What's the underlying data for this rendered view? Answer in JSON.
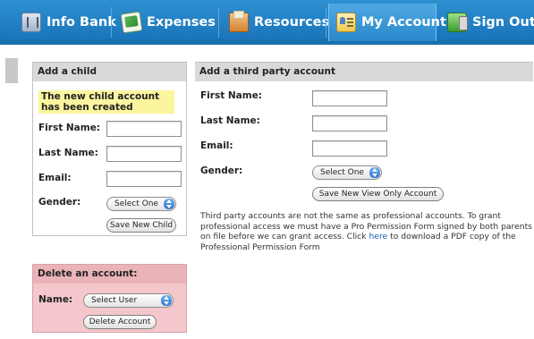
{
  "nav": {
    "items": [
      {
        "label": "Info Bank",
        "icon": "info-bank-icon"
      },
      {
        "label": "Expenses",
        "icon": "expenses-icon"
      },
      {
        "label": "Resources",
        "icon": "resources-icon"
      },
      {
        "label": "My Account",
        "icon": "my-account-icon",
        "active": true
      },
      {
        "label": "Sign Out",
        "icon": "sign-out-icon"
      }
    ]
  },
  "add_child": {
    "title": "Add a child",
    "notice": "The new child account has been created",
    "first_name_label": "First Name:",
    "last_name_label": "Last Name:",
    "email_label": "Email:",
    "gender_label": "Gender:",
    "gender_value": "Select One",
    "save_button": "Save New Child"
  },
  "third_party": {
    "title": "Add a third party account",
    "first_name_label": "First Name:",
    "last_name_label": "Last Name:",
    "email_label": "Email:",
    "gender_label": "Gender:",
    "gender_value": "Select One",
    "save_button": "Save New View Only Account",
    "note_before_link": "Third party accounts are not the same as professional accounts. To grant professional access we must have a Pro Permission Form signed by both parents on file before we can grant access. Click ",
    "note_link": "here",
    "note_after_link": " to download a PDF copy of the Professional Permission Form"
  },
  "delete_account": {
    "title": "Delete an account:",
    "name_label": "Name:",
    "user_value": "Select User",
    "delete_button": "Delete Account"
  },
  "colors": {
    "nav_blue": "#1872b8",
    "notice_yellow": "#fbf5a0",
    "delete_pink": "#f3c7cb",
    "link_blue": "#1f5fb8"
  }
}
